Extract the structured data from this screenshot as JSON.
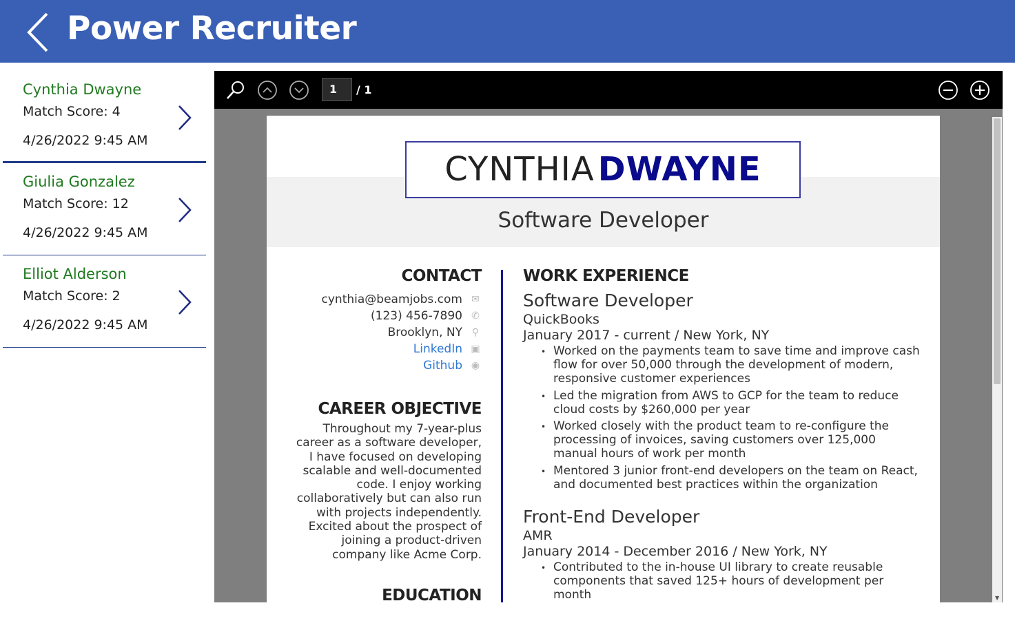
{
  "app": {
    "title": "Power Recruiter",
    "back_icon": "chevron-left-icon"
  },
  "candidates": [
    {
      "name": "Cynthia Dwayne",
      "score": "Match Score: 4",
      "date": "4/26/2022 9:45 AM"
    },
    {
      "name": "Giulia Gonzalez",
      "score": "Match Score: 12",
      "date": "4/26/2022 9:45 AM"
    },
    {
      "name": "Elliot Alderson",
      "score": "Match Score: 2",
      "date": "4/26/2022 9:45 AM"
    }
  ],
  "viewer": {
    "current_page": "1",
    "total_pages": "/ 1",
    "icons": [
      "search-icon",
      "page-up-icon",
      "page-down-icon",
      "zoom-out-icon",
      "zoom-in-icon"
    ]
  },
  "resume": {
    "first_name": "CYNTHIA",
    "last_name": "DWAYNE",
    "title": "Software Developer",
    "contact_heading": "CONTACT",
    "contact": [
      {
        "text": "cynthia@beamjobs.com",
        "icon": "envelope-icon"
      },
      {
        "text": "(123) 456-7890",
        "icon": "phone-icon"
      },
      {
        "text": "Brooklyn, NY",
        "icon": "map-pin-icon"
      },
      {
        "text": "LinkedIn",
        "icon": "linkedin-icon"
      },
      {
        "text": "Github",
        "icon": "github-icon"
      }
    ],
    "objective_heading": "CAREER OBJECTIVE",
    "objective": "Throughout my 7-year-plus career as a software developer, I have focused on developing scalable and well-documented code. I enjoy working collaboratively but can also run with projects independently. Excited about the prospect of joining a product-driven company like Acme Corp.",
    "education_heading": "EDUCATION",
    "experience_heading": "WORK EXPERIENCE",
    "jobs": [
      {
        "role": "Software Developer",
        "company": "QuickBooks",
        "dates": "January 2017 - current  /  New York, NY",
        "bullets": [
          "Worked on the payments team to save time and improve cash flow for over 50,000 through the development of modern, responsive customer experiences",
          "Led the migration from AWS to GCP for the team to reduce cloud costs by $260,000 per year",
          "Worked closely with the product team to re-configure the processing of invoices, saving customers over 125,000 manual hours of work per month",
          "Mentored 3 junior front-end developers on the team on React, and documented best practices within the organization"
        ]
      },
      {
        "role": "Front-End Developer",
        "company": "AMR",
        "dates": "January 2014 - December 2016  /  New York, NY",
        "bullets": [
          "Contributed to the in-house UI library to create reusable components that saved 125+ hours of development per month"
        ]
      }
    ]
  },
  "colors": {
    "header_bg": "#3a60b5",
    "candidate_name": "#1f7a1f",
    "accent_navy": "#1e3a8a",
    "link": "#2f78d6"
  }
}
